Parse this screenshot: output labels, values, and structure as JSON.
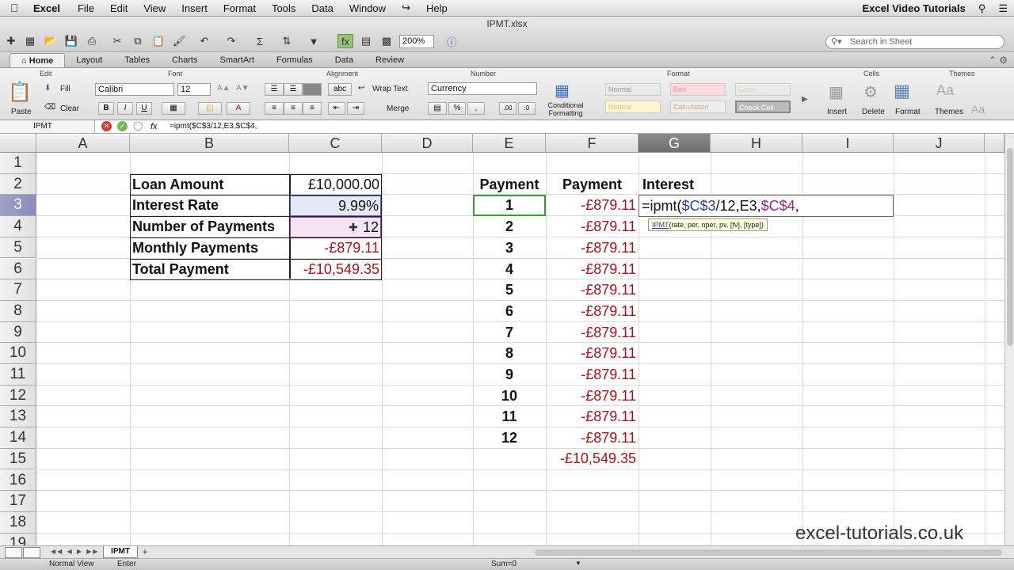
{
  "menubar": {
    "app_name": "Excel",
    "items": [
      "File",
      "Edit",
      "View",
      "Insert",
      "Format",
      "Tools",
      "Data",
      "Window",
      "Help"
    ],
    "right_title": "Excel Video Tutorials"
  },
  "toolbar": {
    "doc_title": "IPMT.xlsx",
    "zoom": "200%",
    "search_placeholder": "Search in Sheet"
  },
  "ribbon_tabs": [
    "Home",
    "Layout",
    "Tables",
    "Charts",
    "SmartArt",
    "Formulas",
    "Data",
    "Review"
  ],
  "ribbon": {
    "groups": {
      "edit": "Edit",
      "font": "Font",
      "alignment": "Alignment",
      "number": "Number",
      "format": "Format",
      "cells": "Cells",
      "themes": "Themes"
    },
    "paste": "Paste",
    "fill": "Fill",
    "clear": "Clear",
    "font_name": "Calibri",
    "font_size": "12",
    "bold": "B",
    "italic": "I",
    "underline": "U",
    "wrap_text": "Wrap Text",
    "merge": "Merge",
    "abc": "abc",
    "number_format": "Currency",
    "conditional_formatting": "Conditional Formatting",
    "styles": [
      "Normal",
      "Bad",
      "Good",
      "Neutral",
      "Calculation",
      "Check Cell"
    ],
    "insert": "Insert",
    "delete": "Delete",
    "format_btn": "Format",
    "themes_btn": "Themes"
  },
  "formula_bar": {
    "name_box": "IPMT",
    "fx": "fx",
    "content": "=ipmt($C$3/12,E3,$C$4,"
  },
  "columns": [
    "A",
    "B",
    "C",
    "D",
    "E",
    "F",
    "G",
    "H",
    "I",
    "J"
  ],
  "rows": [
    "1",
    "2",
    "3",
    "4",
    "5",
    "6",
    "7",
    "8",
    "9",
    "10",
    "11",
    "12",
    "13",
    "14",
    "15",
    "16",
    "17",
    "18",
    "19"
  ],
  "loan_table": [
    {
      "label": "Loan Amount",
      "value": "£10,000.00",
      "red": false
    },
    {
      "label": "Interest Rate",
      "value": "9.99%",
      "red": false
    },
    {
      "label": "Number of Payments",
      "value": "12",
      "red": false
    },
    {
      "label": "Monthly Payments",
      "value": "-£879.11",
      "red": true
    },
    {
      "label": "Total Payment",
      "value": "-£10,549.35",
      "red": true
    }
  ],
  "headers": {
    "e": "Payment",
    "f": "Payment",
    "g": "Interest"
  },
  "payments": [
    "1",
    "2",
    "3",
    "4",
    "5",
    "6",
    "7",
    "8",
    "9",
    "10",
    "11",
    "12"
  ],
  "payment_amount": "-£879.11",
  "total": "-£10,549.35",
  "editing": {
    "prefix": "=ipmt(",
    "ref1": "$C$3",
    "mid": "/12,E3,",
    "ref2": "$C$4",
    "suffix": ","
  },
  "tooltip": {
    "fn": "IPMT",
    "args": "(rate, per, nper, pv, [fv], [type])"
  },
  "sheet_tab": "IPMT",
  "status": {
    "view": "Normal View",
    "mode": "Enter",
    "sum": "Sum=0"
  },
  "watermark": "excel-tutorials.co.uk"
}
